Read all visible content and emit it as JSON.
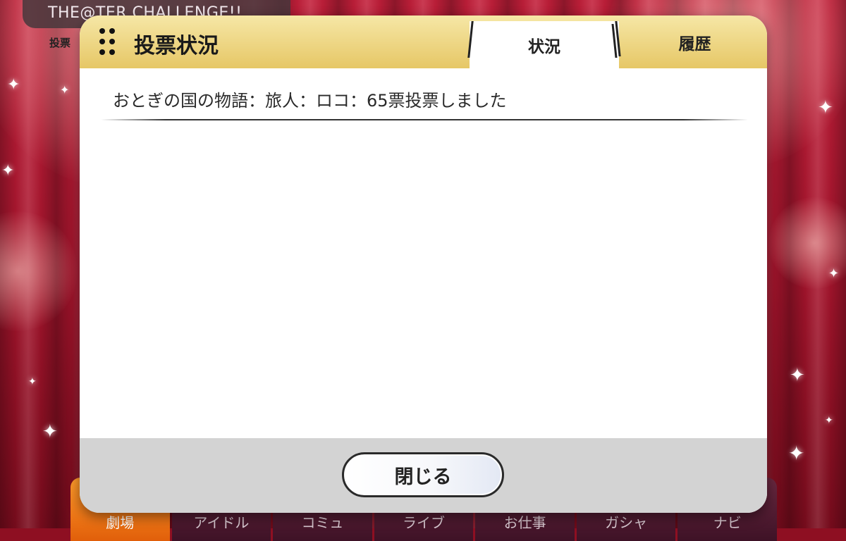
{
  "background": {
    "banner_title": "THE@TER CHALLENGE!!",
    "sub_label": "投票",
    "nav": [
      "劇場",
      "アイドル",
      "コミュ",
      "ライブ",
      "お仕事",
      "ガシャ",
      "ナビ"
    ],
    "colors": {
      "curtain": "#b0182f",
      "nav_active": "#f07a1a"
    }
  },
  "modal": {
    "title": "投票状況",
    "tabs": [
      {
        "label": "状況",
        "active": true
      },
      {
        "label": "履歴",
        "active": false
      }
    ],
    "entries": [
      "おとぎの国の物語：旅人：ロコ：65票投票しました"
    ],
    "close_label": "閉じる",
    "colors": {
      "header": "#ecd27e",
      "footer": "#d3d3d3"
    }
  }
}
